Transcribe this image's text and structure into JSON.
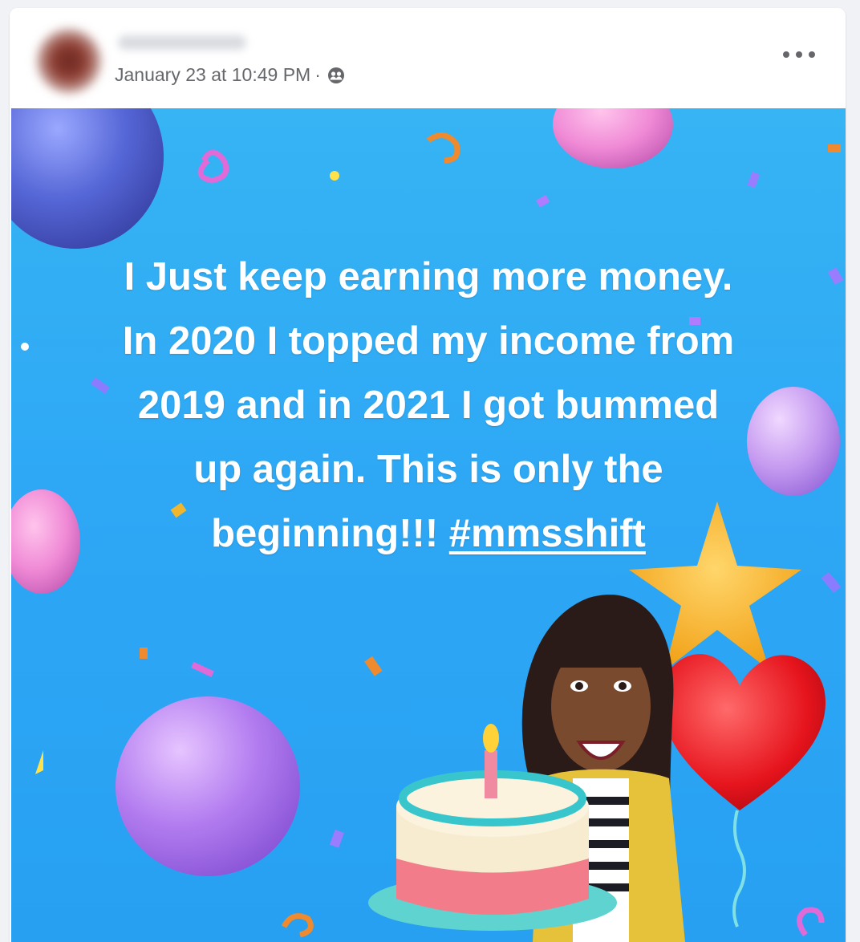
{
  "post": {
    "timestamp": "January 23 at 10:49 PM",
    "separator": "·",
    "audience_icon": "friends-icon",
    "more_icon": "more-options-icon",
    "text_lines": [
      "I Just keep earning more money.",
      "In 2020 I topped my income from",
      "2019 and in 2021 I got bummed",
      "up again. This is only the",
      "beginning!!!"
    ],
    "hashtag": "#mmsshift",
    "background_color": "#2ea8f5",
    "text_color": "#ffffff"
  }
}
